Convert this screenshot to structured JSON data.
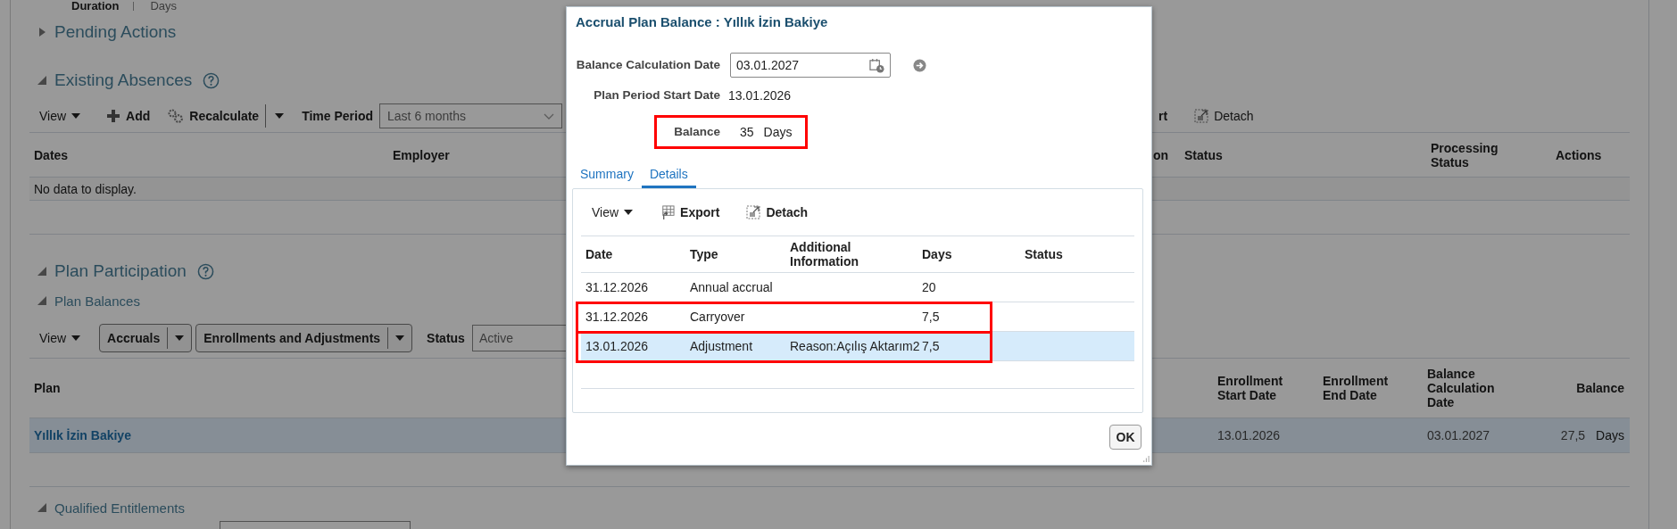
{
  "background": {
    "duration": {
      "label": "Duration",
      "unit": "Days"
    },
    "pending_actions": {
      "title": "Pending Actions",
      "expanded": false
    },
    "existing_absences": {
      "title": "Existing Absences",
      "expanded": true,
      "toolbar": {
        "view": "View",
        "add": "Add",
        "recalculate": "Recalculate",
        "time_period_label": "Time Period",
        "time_period_value": "Last 6 months",
        "export_fragment": "rt",
        "detach": "Detach"
      },
      "columns": [
        "Dates",
        "Employer",
        "on",
        "Status",
        "Processing Status",
        "Actions"
      ],
      "empty_message": "No data to display."
    },
    "plan_participation": {
      "title": "Plan Participation",
      "expanded": true
    },
    "plan_balances": {
      "title": "Plan Balances",
      "expanded": true,
      "toolbar": {
        "view": "View",
        "accruals": "Accruals",
        "enrollments": "Enrollments and Adjustments",
        "status_label": "Status",
        "status_value": "Active"
      },
      "columns": [
        "Plan",
        "Enrollment Start Date",
        "Enrollment End Date",
        "Balance Calculation Date",
        "Balance"
      ],
      "rows": [
        {
          "plan": "Yıllık İzin Bakiye",
          "enrollment_start_date": "13.01.2026",
          "balance_calculation_date": "03.01.2027",
          "balance": "27,5",
          "unit": "Days",
          "selected": true
        }
      ]
    },
    "qualified_entitlements": {
      "title": "Qualified Entitlements",
      "expanded": true
    }
  },
  "dialog": {
    "title": "Accrual Plan Balance : Yıllık İzin Bakiye",
    "balance_calculation_date": {
      "label": "Balance Calculation Date",
      "value": "03.01.2027"
    },
    "plan_period_start_date": {
      "label": "Plan Period Start Date",
      "value": "13.01.2026"
    },
    "balance": {
      "label": "Balance",
      "value": "35",
      "unit": "Days",
      "highlighted": true
    },
    "tabs": [
      {
        "label": "Summary",
        "selected": false
      },
      {
        "label": "Details",
        "selected": true
      }
    ],
    "toolbar": {
      "view": "View",
      "export": "Export",
      "detach": "Detach"
    },
    "columns": [
      "Date",
      "Type",
      "Additional Information",
      "Days",
      "Status"
    ],
    "rows": [
      {
        "date": "31.12.2026",
        "type": "Annual accrual",
        "days": "20",
        "selected": false,
        "highlighted": false
      },
      {
        "date": "31.12.2026",
        "type": "Carryover",
        "days": "7,5",
        "selected": false,
        "highlighted": true
      },
      {
        "date": "13.01.2026",
        "type": "Adjustment",
        "additional_information": "Reason:Açılış Aktarım2",
        "days": "7,5",
        "selected": true,
        "highlighted": true
      }
    ],
    "ok": "OK"
  }
}
